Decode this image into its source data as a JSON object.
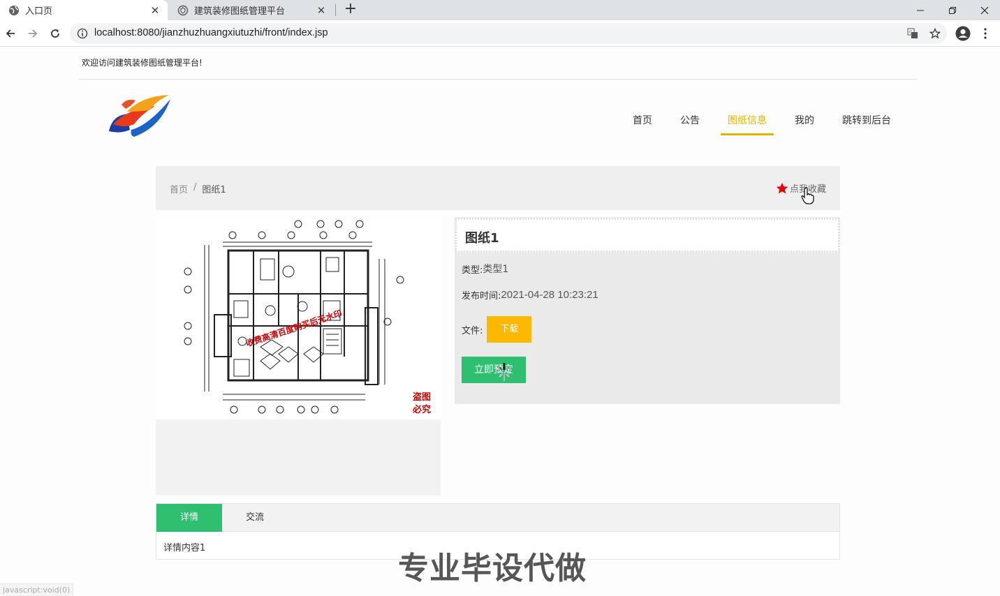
{
  "browser": {
    "tabs": [
      {
        "title": "入口页",
        "active": true
      },
      {
        "title": "建筑装修图纸管理平台",
        "active": false
      }
    ],
    "url": "localhost:8080/jianzhuzhuangxiutuzhi/front/index.jsp"
  },
  "header": {
    "welcome": "欢迎访问建筑装修图纸管理平台!",
    "nav": [
      {
        "label": "首页",
        "active": false
      },
      {
        "label": "公告",
        "active": false
      },
      {
        "label": "图纸信息",
        "active": true
      },
      {
        "label": "我的",
        "active": false
      },
      {
        "label": "跳转到后台",
        "active": false
      }
    ]
  },
  "breadcrumb": {
    "home": "首页",
    "separator": "/",
    "current": "图纸1",
    "favorite_label": "点我收藏"
  },
  "image_watermark": {
    "diagonal": "收费高清百度购买后无水印",
    "seal_line1": "盗图",
    "seal_line2": "必究"
  },
  "detail": {
    "title": "图纸1",
    "type_label": "类型:",
    "type_value": "类型1",
    "time_label": "发布时间:",
    "time_value": "2021-04-28 10:23:21",
    "file_label": "文件:",
    "download_label": "下载",
    "buy_label": "立即预定"
  },
  "tabs": {
    "items": [
      "详情",
      "交流"
    ],
    "content": "详情内容1"
  },
  "overlay_text": "专业毕设代做",
  "status_text": "javascript:void(0)",
  "colors": {
    "accent_yellow": "#e6b400",
    "download_orange": "#fdb800",
    "green": "#2fbf71"
  }
}
